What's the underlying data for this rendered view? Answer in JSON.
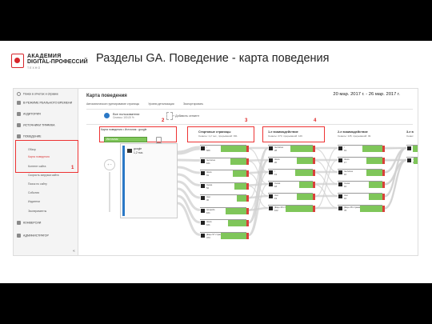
{
  "slide": {
    "title": "Разделы GA. Поведение - карта поведения",
    "logo": {
      "line1": "АКАДЕМИЯ",
      "line2": "DIGITAL-ПРОФЕССИЙ",
      "line3": "ТЕХНО",
      "brand_color": "#d7262b"
    }
  },
  "sidebar": {
    "search_placeholder": "Поиск в отчетах и справке",
    "items": [
      {
        "label": "В РЕЖИМЕ РЕАЛЬНОГО ВРЕМЕНИ",
        "icon": "clock-icon"
      },
      {
        "label": "АУДИТОРИЯ",
        "icon": "person-icon"
      },
      {
        "label": "ИСТОЧНИКИ ТРАФИКА",
        "icon": "flow-icon"
      },
      {
        "label": "ПОВЕДЕНИЕ",
        "icon": "behavior-icon"
      }
    ],
    "behavior_sub": [
      {
        "label": "Обзор",
        "active": false
      },
      {
        "label": "Карта поведения",
        "active": true
      },
      {
        "label": "Контент сайта",
        "active": false
      },
      {
        "label": "Скорость загрузки сайта",
        "active": false
      },
      {
        "label": "Поиск по сайту",
        "active": false
      },
      {
        "label": "События",
        "active": false
      },
      {
        "label": "Издатели",
        "active": false
      },
      {
        "label": "Эксперименты",
        "active": false
      }
    ],
    "bottom_items": [
      {
        "label": "КОНВЕРСИИ",
        "icon": "flag-icon"
      },
      {
        "label": "АДМИНИСТРАТОР",
        "icon": "gear-icon"
      }
    ],
    "collapse_label": "«"
  },
  "report": {
    "title": "Карта поведения",
    "date_range": "20 мар. 2017 г. - 26 мар. 2017 г.",
    "toolbar": [
      "Автоматическое группирование страницы",
      "Уровни детализации",
      "Экспортировать"
    ],
    "segment": {
      "name": "Все пользователи",
      "meta": "Сеансы: 100,00 %",
      "add_label": "+ Добавить сегмент"
    },
    "source": {
      "header": "Карта поведения • Источник : google",
      "selected": "Источник",
      "node_label": "google",
      "node_count": "1,2 тыс."
    },
    "zoom_label": "+ −",
    "columns": [
      {
        "title": "Стартовые страницы",
        "meta": "Сеансы: 1,2 тыс., прерываний: 931"
      },
      {
        "title": "1-е взаимодействие",
        "meta": "Сеансы: 273, прерываний: 129"
      },
      {
        "title": "2-е взаимодействие",
        "meta": "Сеансы: 145, прерываний: 49"
      },
      {
        "title": "3-е в",
        "meta": "Сеанс"
      }
    ],
    "annotations": [
      "1",
      "2",
      "3",
      "4"
    ],
    "col1_nodes": [
      {
        "label": "/",
        "value": "666",
        "fill": 0.55
      },
      {
        "label": "/services",
        "value": "101",
        "fill": 0.35
      },
      {
        "label": "/ducs",
        "value": "91",
        "fill": 0.3
      },
      {
        "label": "/news",
        "value": "52",
        "fill": 0.25
      },
      {
        "label": "/cat",
        "value": "30",
        "fill": 0.2
      },
      {
        "label": "/projects",
        "value": "101",
        "fill": 0.45
      },
      {
        "label": "/ducs",
        "value": "101",
        "fill": 0.4
      },
      {
        "label": "(Еще 97 страниц)",
        "value": "473",
        "fill": 0.55
      }
    ],
    "col2_nodes": [
      {
        "label": "/services",
        "value": "28",
        "fill": 0.5
      },
      {
        "label": "/ducs",
        "value": "20",
        "fill": 0.35
      },
      {
        "label": "/",
        "value": "19",
        "fill": 0.4
      },
      {
        "label": "/news",
        "value": "18",
        "fill": 0.3
      },
      {
        "label": "/cat",
        "value": "19",
        "fill": 0.35
      },
      {
        "label": "(Еще 40 страниц)",
        "value": "102",
        "fill": 0.6
      }
    ],
    "col3_nodes": [
      {
        "label": "/",
        "value": "19",
        "fill": 0.45
      },
      {
        "label": "/ducs",
        "value": "17",
        "fill": 0.35
      },
      {
        "label": "/services",
        "value": "16",
        "fill": 0.35
      },
      {
        "label": "/news",
        "value": "16",
        "fill": 0.3
      },
      {
        "label": "/cat",
        "value": "16",
        "fill": 0.3
      },
      {
        "label": "(Еще 28 страниц)",
        "value": "78",
        "fill": 0.5
      }
    ],
    "col4_nodes": [
      {
        "label": "/",
        "value": "10",
        "fill": 0.4
      },
      {
        "label": "/",
        "value": "9",
        "fill": 0.35
      }
    ],
    "colors": {
      "node_green": "#7fc65a",
      "drop_red": "#d9413a",
      "annotation_red": "#e33333",
      "flow_gray": "#cfcfcf"
    }
  }
}
